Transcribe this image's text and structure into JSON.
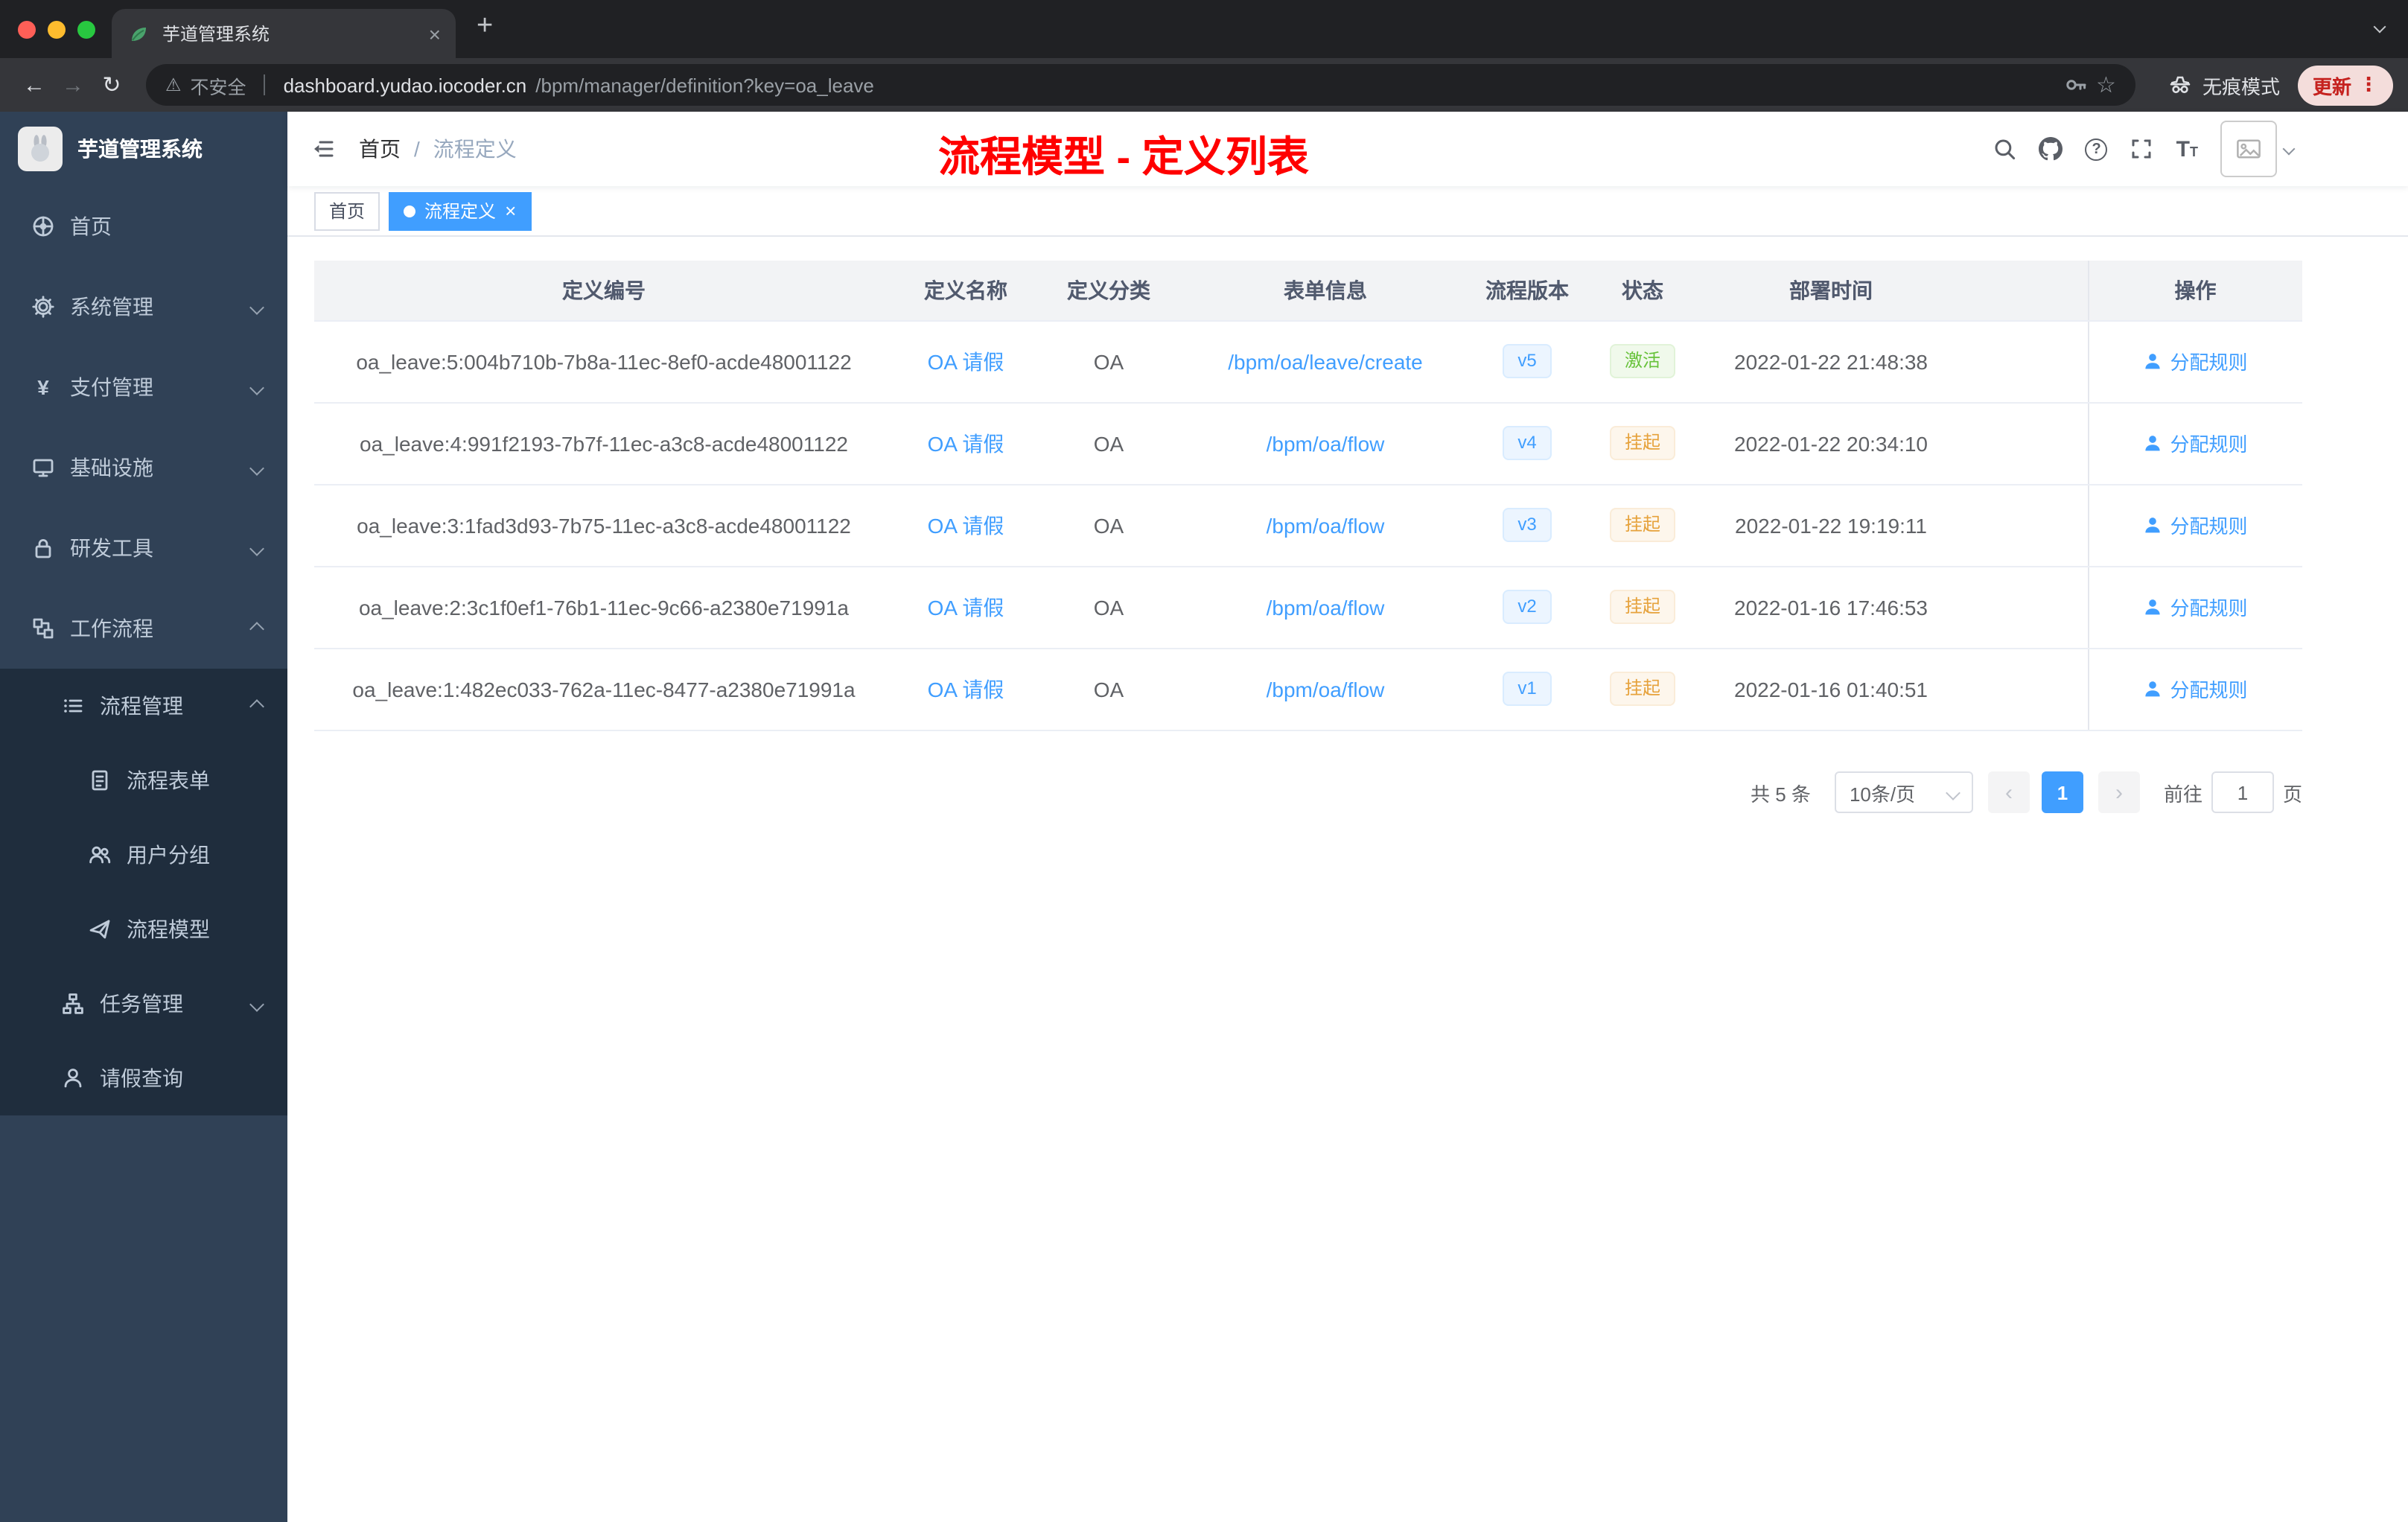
{
  "browser": {
    "tab": {
      "title": "芋道管理系统"
    },
    "address": {
      "security": "不安全",
      "host": "dashboard.yudao.iocoder.cn",
      "path": "/bpm/manager/definition?key=oa_leave"
    },
    "incognito": "无痕模式",
    "update": "更新"
  },
  "sidebar": {
    "logo_title": "芋道管理系统",
    "items": [
      {
        "label": "首页"
      },
      {
        "label": "系统管理"
      },
      {
        "label": "支付管理"
      },
      {
        "label": "基础设施"
      },
      {
        "label": "研发工具"
      },
      {
        "label": "工作流程"
      },
      {
        "label": "流程管理"
      },
      {
        "label": "流程表单"
      },
      {
        "label": "用户分组"
      },
      {
        "label": "流程模型"
      },
      {
        "label": "任务管理"
      },
      {
        "label": "请假查询"
      }
    ]
  },
  "header": {
    "breadcrumb_home": "首页",
    "breadcrumb_sep": "/",
    "breadcrumb_current": "流程定义",
    "overlay_title": "流程模型 - 定义列表"
  },
  "tags": {
    "home": "首页",
    "active": "流程定义"
  },
  "table": {
    "columns": [
      "定义编号",
      "定义名称",
      "定义分类",
      "表单信息",
      "流程版本",
      "状态",
      "部署时间",
      "操作"
    ],
    "rows": [
      {
        "id": "oa_leave:5:004b710b-7b8a-11ec-8ef0-acde48001122",
        "name": "OA 请假",
        "category": "OA",
        "form": "/bpm/oa/leave/create",
        "version": "v5",
        "status": "激活",
        "time": "2022-01-22 21:48:38",
        "action": "分配规则"
      },
      {
        "id": "oa_leave:4:991f2193-7b7f-11ec-a3c8-acde48001122",
        "name": "OA 请假",
        "category": "OA",
        "form": "/bpm/oa/flow",
        "version": "v4",
        "status": "挂起",
        "time": "2022-01-22 20:34:10",
        "action": "分配规则"
      },
      {
        "id": "oa_leave:3:1fad3d93-7b75-11ec-a3c8-acde48001122",
        "name": "OA 请假",
        "category": "OA",
        "form": "/bpm/oa/flow",
        "version": "v3",
        "status": "挂起",
        "time": "2022-01-22 19:19:11",
        "action": "分配规则"
      },
      {
        "id": "oa_leave:2:3c1f0ef1-76b1-11ec-9c66-a2380e71991a",
        "name": "OA 请假",
        "category": "OA",
        "form": "/bpm/oa/flow",
        "version": "v2",
        "status": "挂起",
        "time": "2022-01-16 17:46:53",
        "action": "分配规则"
      },
      {
        "id": "oa_leave:1:482ec033-762a-11ec-8477-a2380e71991a",
        "name": "OA 请假",
        "category": "OA",
        "form": "/bpm/oa/flow",
        "version": "v1",
        "status": "挂起",
        "time": "2022-01-16 01:40:51",
        "action": "分配规则"
      }
    ]
  },
  "pagination": {
    "total": "共 5 条",
    "page_size": "10条/页",
    "current_page": "1",
    "goto_label": "前往",
    "goto_value": "1",
    "page_unit": "页"
  },
  "colors": {
    "accent": "#409eff",
    "success": "#67c23a",
    "warning": "#e6a23c",
    "title_red": "#ff0000",
    "sidebar_bg": "#304156",
    "sidebar_sub_bg": "#1f2d3d"
  }
}
